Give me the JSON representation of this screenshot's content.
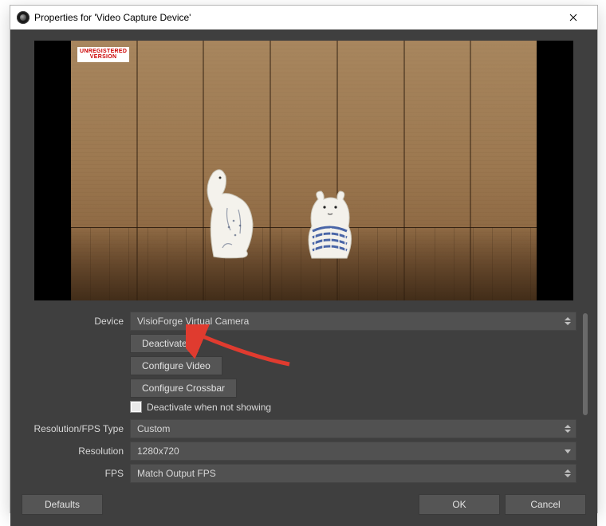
{
  "window": {
    "title": "Properties for 'Video Capture Device'"
  },
  "preview": {
    "watermark": "UNREGISTERED\nVERSION"
  },
  "form": {
    "device_label": "Device",
    "device_value": "VisioForge Virtual Camera",
    "deactivate_label": "Deactivate",
    "configure_video_label": "Configure Video",
    "configure_crossbar_label": "Configure Crossbar",
    "deactivate_when_not_showing_label": "Deactivate when not showing",
    "resfps_type_label": "Resolution/FPS Type",
    "resfps_type_value": "Custom",
    "resolution_label": "Resolution",
    "resolution_value": "1280x720",
    "fps_label": "FPS",
    "fps_value": "Match Output FPS"
  },
  "footer": {
    "defaults_label": "Defaults",
    "ok_label": "OK",
    "cancel_label": "Cancel"
  }
}
